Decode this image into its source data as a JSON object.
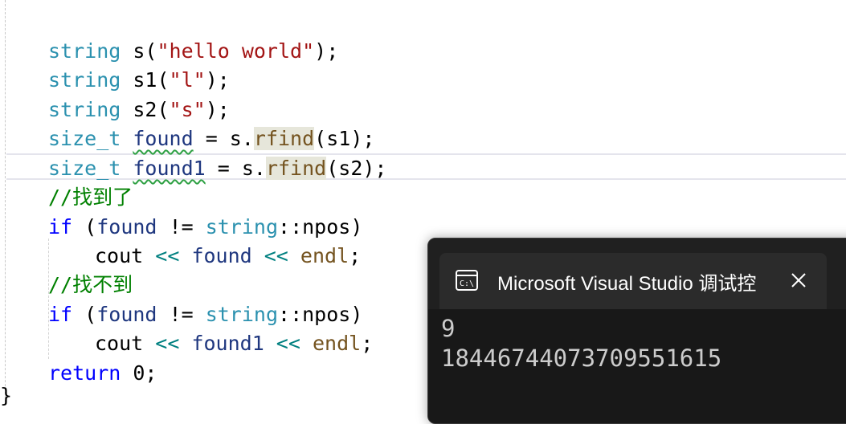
{
  "editor": {
    "lines": {
      "l1": {
        "type": "string",
        "rest_a": " s(",
        "literal": "\"hello world\"",
        "rest_b": ");"
      },
      "l2": {
        "type": "string",
        "rest_a": " s1(",
        "literal": "\"l\"",
        "rest_b": ");"
      },
      "l3": {
        "type": "string",
        "rest_a": " s2(",
        "literal": "\"s\"",
        "rest_b": ");"
      },
      "l4": {
        "type": "size_t",
        "var": "found",
        "mid": " = s.",
        "fn": "rfind",
        "args": "(s1);"
      },
      "l5": {
        "type": "size_t",
        "var": "found1",
        "mid": " = s.",
        "fn": "rfind",
        "args": "(s2);"
      },
      "l6": {
        "comment": "//找到了"
      },
      "l7": {
        "kw": "if",
        "open": " (",
        "var": "found",
        "op": " != ",
        "type": "string",
        "scope": "::npos)"
      },
      "l8": {
        "ident": "cout",
        "op1": " << ",
        "var": "found",
        "op2": " << ",
        "fn": "endl",
        "end": ";"
      },
      "l9": {
        "comment": "//找不到"
      },
      "l10": {
        "kw": "if",
        "open": " (",
        "var": "found",
        "op": " != ",
        "type": "string",
        "scope": "::npos)"
      },
      "l11": {
        "ident": "cout",
        "op1": " << ",
        "var": "found1",
        "op2": " << ",
        "fn": "endl",
        "end": ";"
      },
      "l12": {
        "kw": "return",
        "rest": " 0;"
      },
      "closing_brace": "}"
    }
  },
  "console": {
    "icon": "console-app-icon",
    "title": "Microsoft Visual Studio 调试控",
    "close_icon": "close-icon",
    "output": [
      "9",
      "18446744073709551615"
    ]
  },
  "colors": {
    "keyword": "#0000ff",
    "type": "#2b91af",
    "string": "#a31515",
    "function": "#74531f",
    "variable": "#1f377f",
    "comment": "#008000",
    "console_bg": "#181818"
  }
}
